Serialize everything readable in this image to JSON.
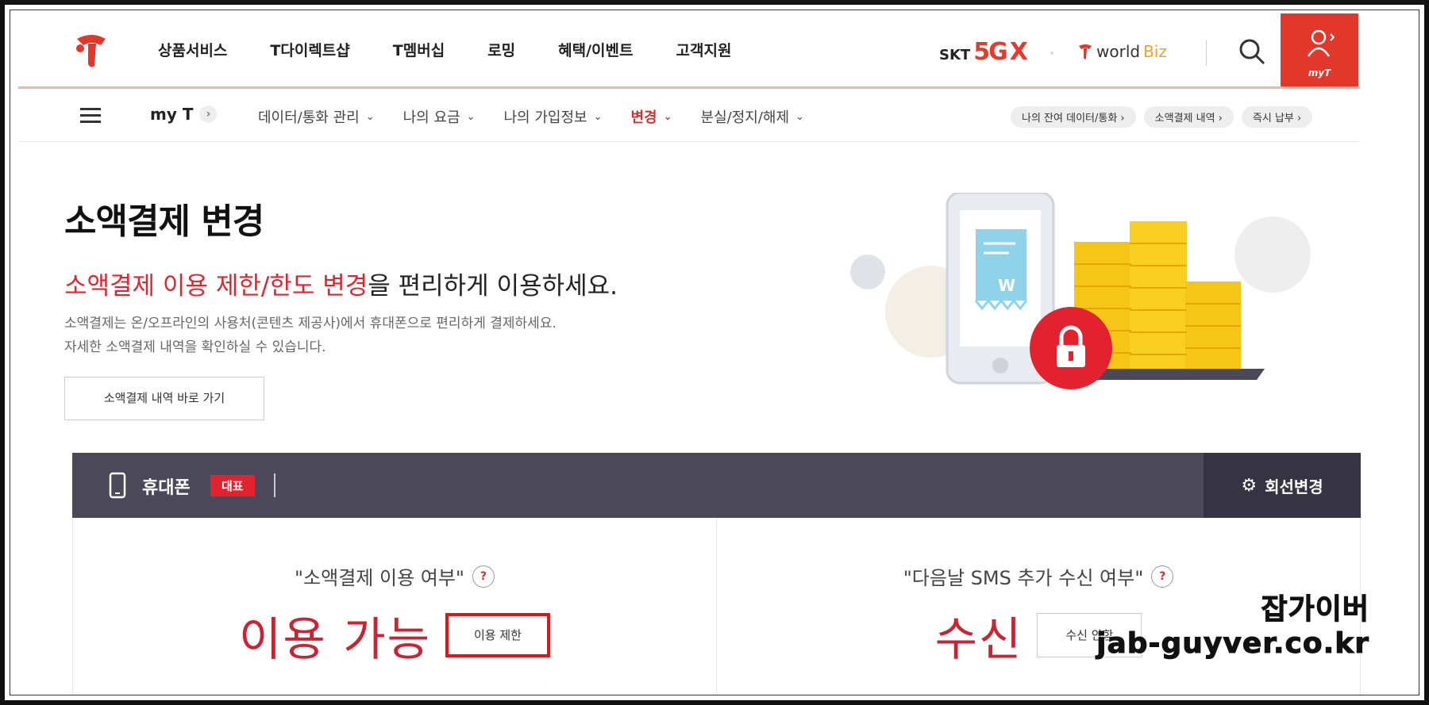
{
  "header": {
    "nav": [
      "상품서비스",
      "T다이렉트샵",
      "T멤버십",
      "로밍",
      "혜택/이벤트",
      "고객지원"
    ],
    "brand_skt_prefix": "SKT",
    "brand_skt_5g": "5G",
    "brand_skt_x": "X",
    "brand_world": "world",
    "brand_world_biz": "Biz",
    "myt_label": "myT"
  },
  "subnav": {
    "myt": "my T",
    "items": [
      {
        "label": "데이터/통화 관리"
      },
      {
        "label": "나의 요금"
      },
      {
        "label": "나의 가입정보"
      },
      {
        "label": "변경"
      },
      {
        "label": "분실/정지/해제"
      }
    ],
    "quick": [
      "나의 잔여 데이터/통화",
      "소액결제 내역",
      "즉시 납부"
    ]
  },
  "hero": {
    "title": "소액결제 변경",
    "sub_highlight": "소액결제 이용 제한/한도 변경",
    "sub_rest": "을 편리하게 이용하세요.",
    "desc_line1": "소액결제는 온/오프라인의 사용처(콘텐츠 제공사)에서 휴대폰으로 편리하게 결제하세요.",
    "desc_line2": "자세한 소액결제 내역을 확인하실 수 있습니다.",
    "button": "소액결제 내역 바로 가기",
    "illustration_currency": "W"
  },
  "line_bar": {
    "name": "휴대폰",
    "badge": "대표",
    "change": "회선변경"
  },
  "panels": {
    "left": {
      "question": "\"소액결제 이용 여부\"",
      "status": "이용 가능",
      "button": "이용 제한"
    },
    "right": {
      "question": "\"다음날 SMS 추가 수신 여부\"",
      "status": "수신",
      "button": "수신 안함"
    },
    "help_glyph": "?"
  },
  "watermark": {
    "line1": "잡가이버",
    "line2": "jab-guyver.co.kr"
  },
  "colors": {
    "brand_red": "#e2372b",
    "status_red": "#c92434",
    "bar_dark": "#4a4859"
  }
}
